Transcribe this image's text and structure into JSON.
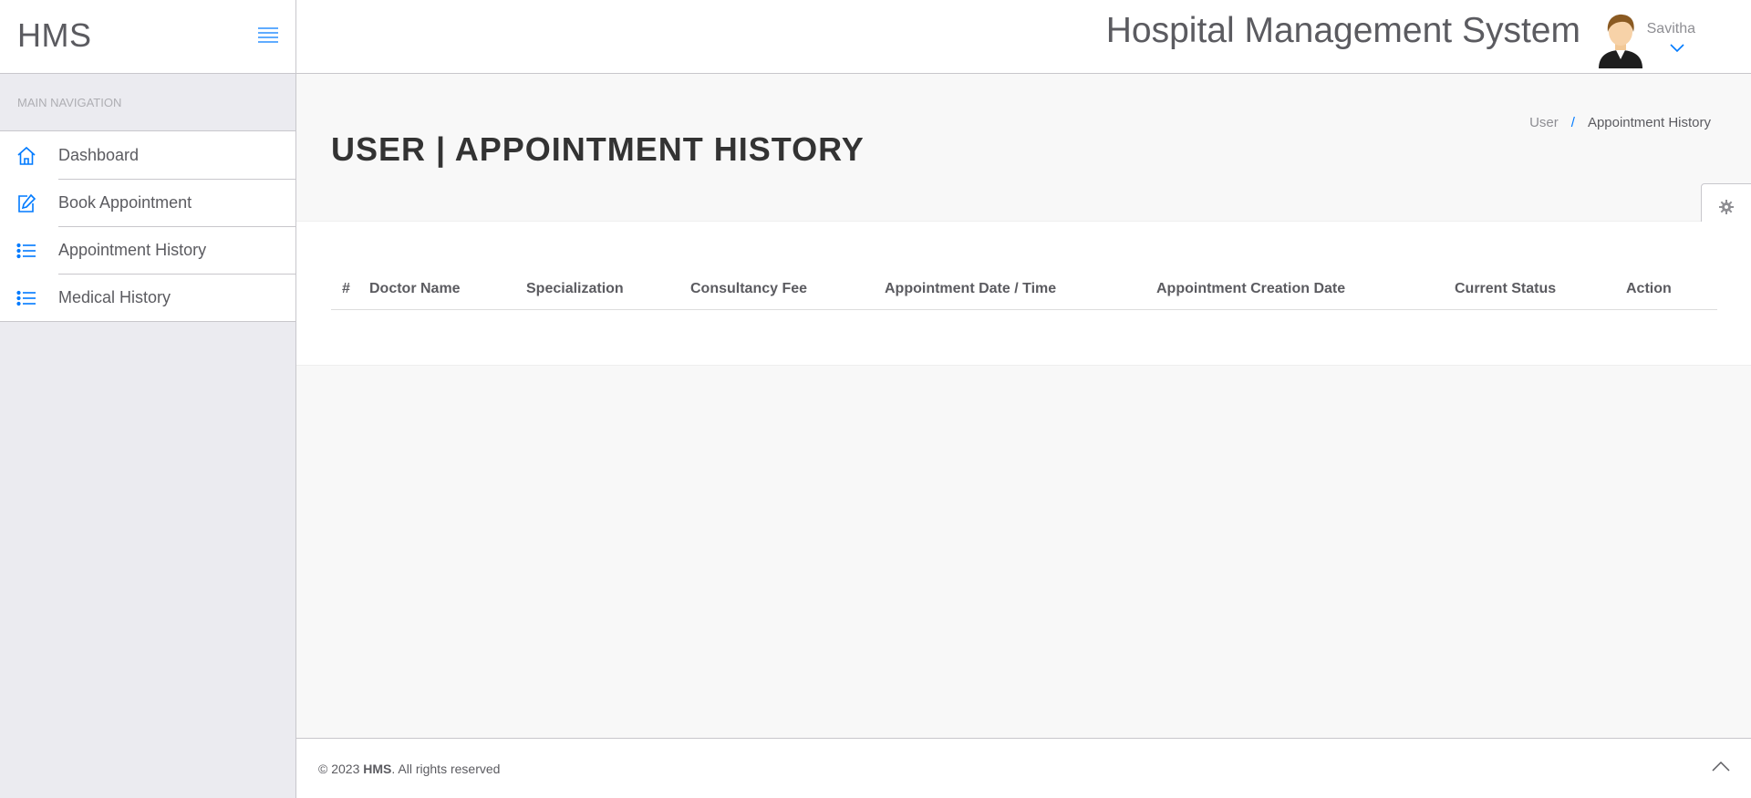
{
  "brand": {
    "logo": "HMS"
  },
  "header": {
    "title": "Hospital Management System",
    "username": "Savitha"
  },
  "sidebar": {
    "heading": "MAIN NAVIGATION",
    "items": [
      {
        "label": "Dashboard",
        "icon": "home-icon"
      },
      {
        "label": "Book Appointment",
        "icon": "edit-icon"
      },
      {
        "label": "Appointment History",
        "icon": "list-icon"
      },
      {
        "label": "Medical History",
        "icon": "list-icon"
      }
    ]
  },
  "page": {
    "title": "USER | APPOINTMENT HISTORY",
    "breadcrumb": {
      "parent": "User",
      "separator": "/",
      "current": "Appointment History"
    }
  },
  "table": {
    "columns": [
      "#",
      "Doctor Name",
      "Specialization",
      "Consultancy Fee",
      "Appointment Date / Time",
      "Appointment Creation Date",
      "Current Status",
      "Action"
    ],
    "rows": []
  },
  "footer": {
    "prefix": "© 2023 ",
    "brand": "HMS",
    "suffix": ". All rights reserved"
  },
  "colors": {
    "accent": "#007aff",
    "text": "#5b5b60",
    "sidebar_bg": "#ebebf0"
  }
}
